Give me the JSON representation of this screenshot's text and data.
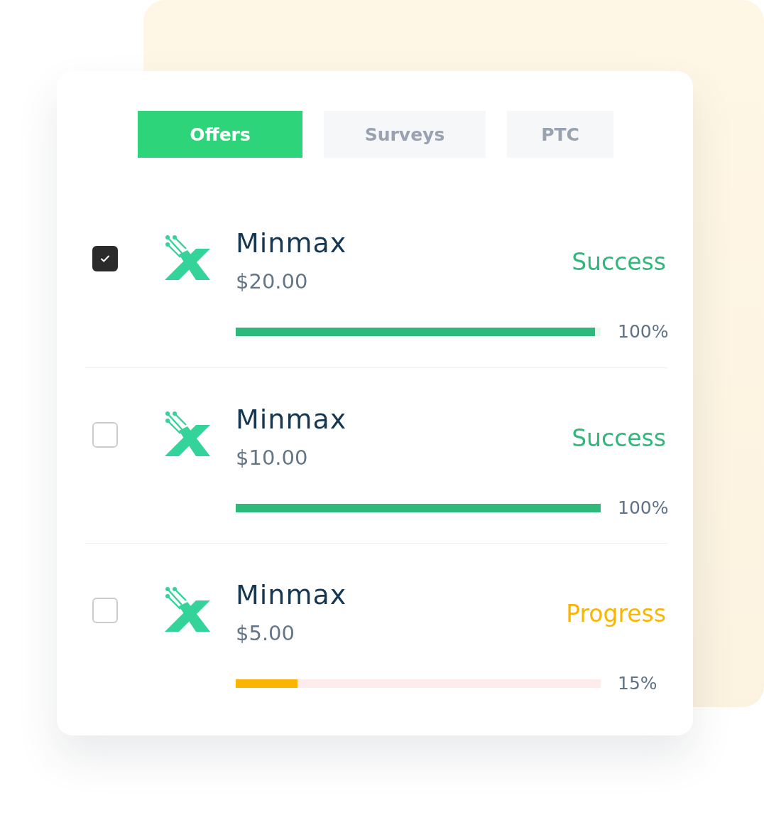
{
  "tabs": [
    {
      "label": "Offers",
      "selected": true
    },
    {
      "label": "Surveys",
      "selected": false
    },
    {
      "label": "PTC",
      "selected": false
    }
  ],
  "offers": [
    {
      "checked": true,
      "name": "Minmax",
      "amount": "$20.00",
      "status": "Success",
      "kind": "success",
      "color": "#2eb87a",
      "level": 0.984,
      "reading": "100%"
    },
    {
      "checked": false,
      "name": "Minmax",
      "amount": "$10.00",
      "status": "Success",
      "kind": "success",
      "color": "#2eb87a",
      "level": 1,
      "reading": "100%"
    },
    {
      "checked": false,
      "name": "Minmax",
      "amount": "$5.00",
      "status": "Progress",
      "kind": "progress",
      "color": "#fbb500",
      "level": 0.17,
      "reading": "15%"
    }
  ]
}
